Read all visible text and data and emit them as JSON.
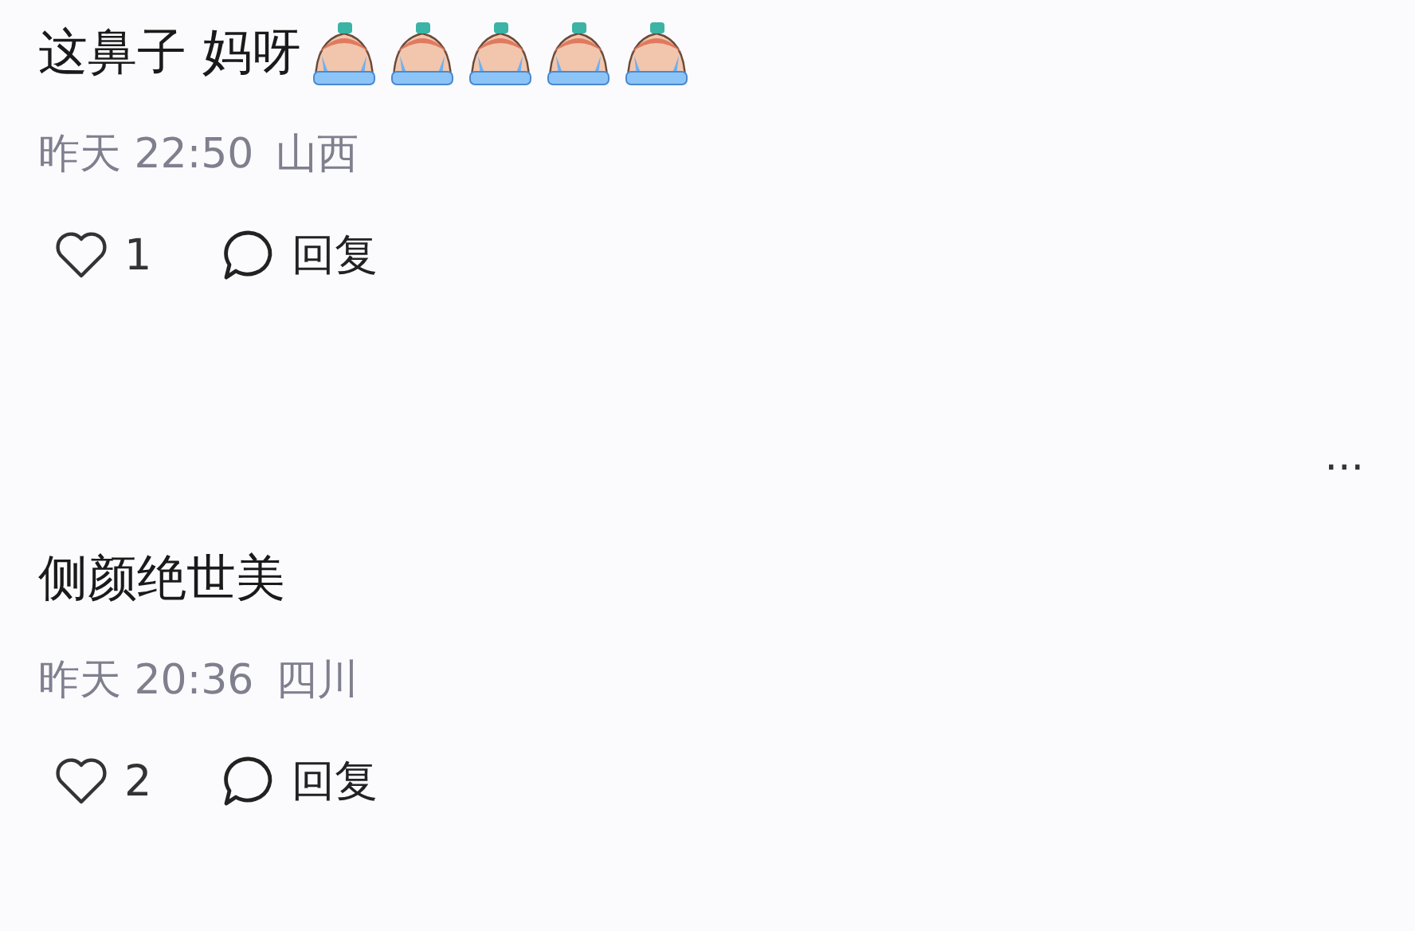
{
  "comments": [
    {
      "text": "这鼻子 妈呀",
      "stickers": [
        {
          "kind": "crying"
        },
        {
          "kind": "crying"
        },
        {
          "kind": "crying"
        },
        {
          "kind": "crying"
        },
        {
          "kind": "crying"
        }
      ],
      "time": "昨天 22:50",
      "location": "山西",
      "likes": "1",
      "reply_label": "回复"
    },
    {
      "text": "侧颜绝世美",
      "time": "昨天 20:36",
      "location": "四川",
      "likes": "2",
      "reply_label": "回复"
    }
  ],
  "more_label": "···"
}
